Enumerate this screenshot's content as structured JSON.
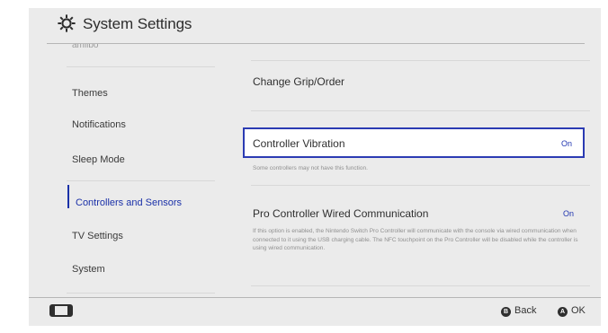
{
  "header": {
    "title": "System Settings",
    "icon": "gear-icon"
  },
  "sidebar": {
    "cut_item": "amiibo",
    "items": [
      {
        "label": "Themes",
        "selected": false
      },
      {
        "label": "Notifications",
        "selected": false
      },
      {
        "label": "Sleep Mode",
        "selected": false
      },
      {
        "label": "Controllers and Sensors",
        "selected": true
      },
      {
        "label": "TV Settings",
        "selected": false
      },
      {
        "label": "System",
        "selected": false
      }
    ]
  },
  "content": {
    "rows": [
      {
        "label": "Change Grip/Order",
        "value": "",
        "description": ""
      },
      {
        "label": "Controller Vibration",
        "value": "On",
        "description": "Some controllers may not have this function.",
        "focused": true
      },
      {
        "label": "Pro Controller Wired Communication",
        "value": "On",
        "description": "If this option is enabled, the Nintendo Switch Pro Controller will communicate with the console via wired communication when connected to it using the USB charging cable. The NFC touchpoint on the Pro Controller will be disabled while the controller is using wired communication."
      }
    ]
  },
  "footer": {
    "controller_icon": "controller-icon",
    "back": {
      "glyph": "B",
      "label": "Back"
    },
    "ok": {
      "glyph": "A",
      "label": "OK"
    }
  },
  "colors": {
    "accent": "#2b3bb3",
    "background": "#ebebeb",
    "focus_background": "#ffffff"
  }
}
